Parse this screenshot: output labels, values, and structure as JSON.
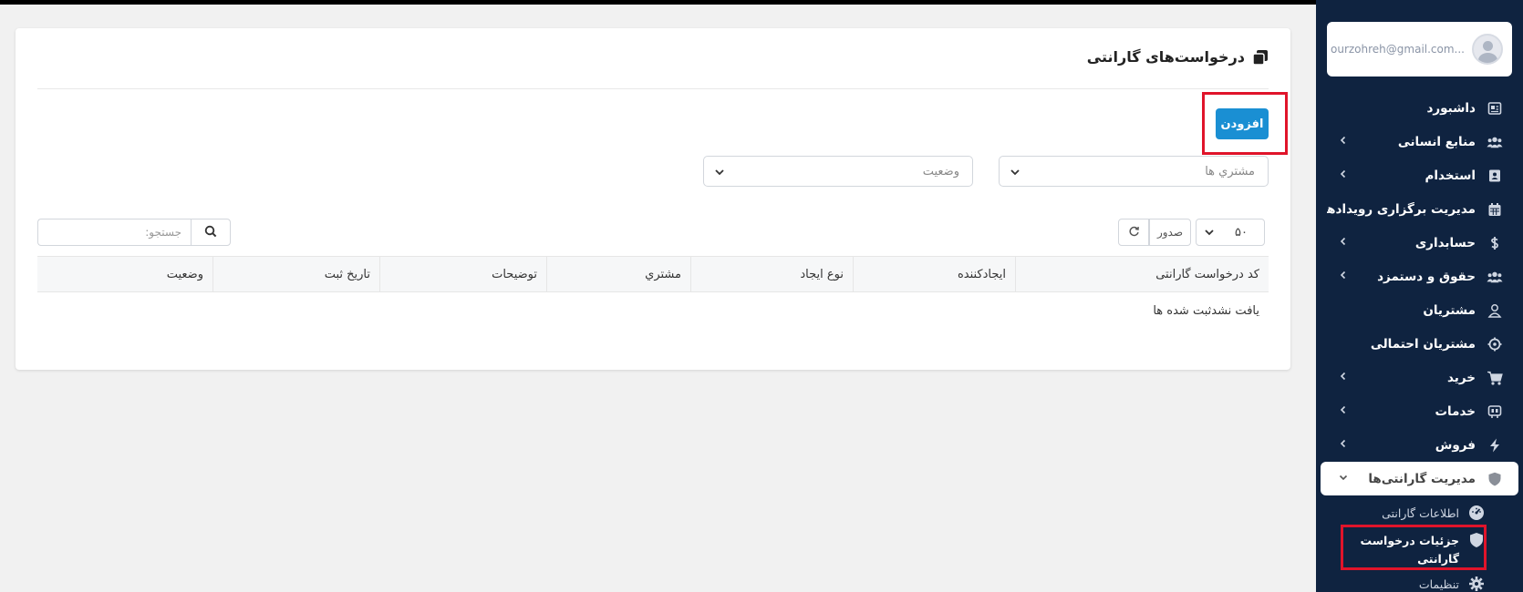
{
  "sidebar": {
    "profile": {
      "email": "ourzohreh@gmail.com..."
    },
    "items": [
      {
        "label": "داشبورد",
        "icon": "dashboard-icon",
        "has_children": false
      },
      {
        "label": "منابع انسانی",
        "icon": "users-icon",
        "has_children": true
      },
      {
        "label": "استخدام",
        "icon": "id-card-icon",
        "has_children": true
      },
      {
        "label": "مدیریت برگزاری رویدادها",
        "icon": "calendar-icon",
        "has_children": false
      },
      {
        "label": "حسابداری",
        "icon": "dollar-icon",
        "has_children": true
      },
      {
        "label": "حقوق و دستمزد",
        "icon": "users-group-icon",
        "has_children": true
      },
      {
        "label": "مشتریان",
        "icon": "user-icon",
        "has_children": false
      },
      {
        "label": "مشتریان احتمالی",
        "icon": "crosshair-icon",
        "has_children": false
      },
      {
        "label": "خرید",
        "icon": "cart-icon",
        "has_children": true
      },
      {
        "label": "خدمات",
        "icon": "services-icon",
        "has_children": true
      },
      {
        "label": "فروش",
        "icon": "bolt-icon",
        "has_children": true
      },
      {
        "label": "مدیریت گارانتی‌ها",
        "icon": "shield-icon",
        "has_children": true,
        "active": true
      }
    ],
    "submenu": [
      {
        "label": "اطلاعات گارانتی",
        "icon": "gauge-icon"
      },
      {
        "label": "جزئیات درخواست گارانتی",
        "icon": "shield-icon",
        "selected": true
      },
      {
        "label": "تنظیمات",
        "icon": "gear-icon"
      }
    ]
  },
  "page": {
    "title": "درخواست‌های گارانتی",
    "add_label": "افزودن",
    "filters": {
      "customers_placeholder": "مشتري ها",
      "status_placeholder": "وضعیت"
    },
    "toolbar": {
      "page_length": "۵۰",
      "export_label": "صدور",
      "search_placeholder": "جستجو:"
    },
    "table": {
      "columns": [
        "کد درخواست گارانتی",
        "ایجادکننده",
        "نوع ایجاد",
        "مشتري",
        "توضیحات",
        "تاریخ ثبت",
        "وضعیت"
      ],
      "empty_text": "یافت نشدثبت شده ها"
    }
  },
  "colors": {
    "sidebar_bg": "#0f2340",
    "primary": "#1a8fd3",
    "highlight": "#e0142a"
  }
}
